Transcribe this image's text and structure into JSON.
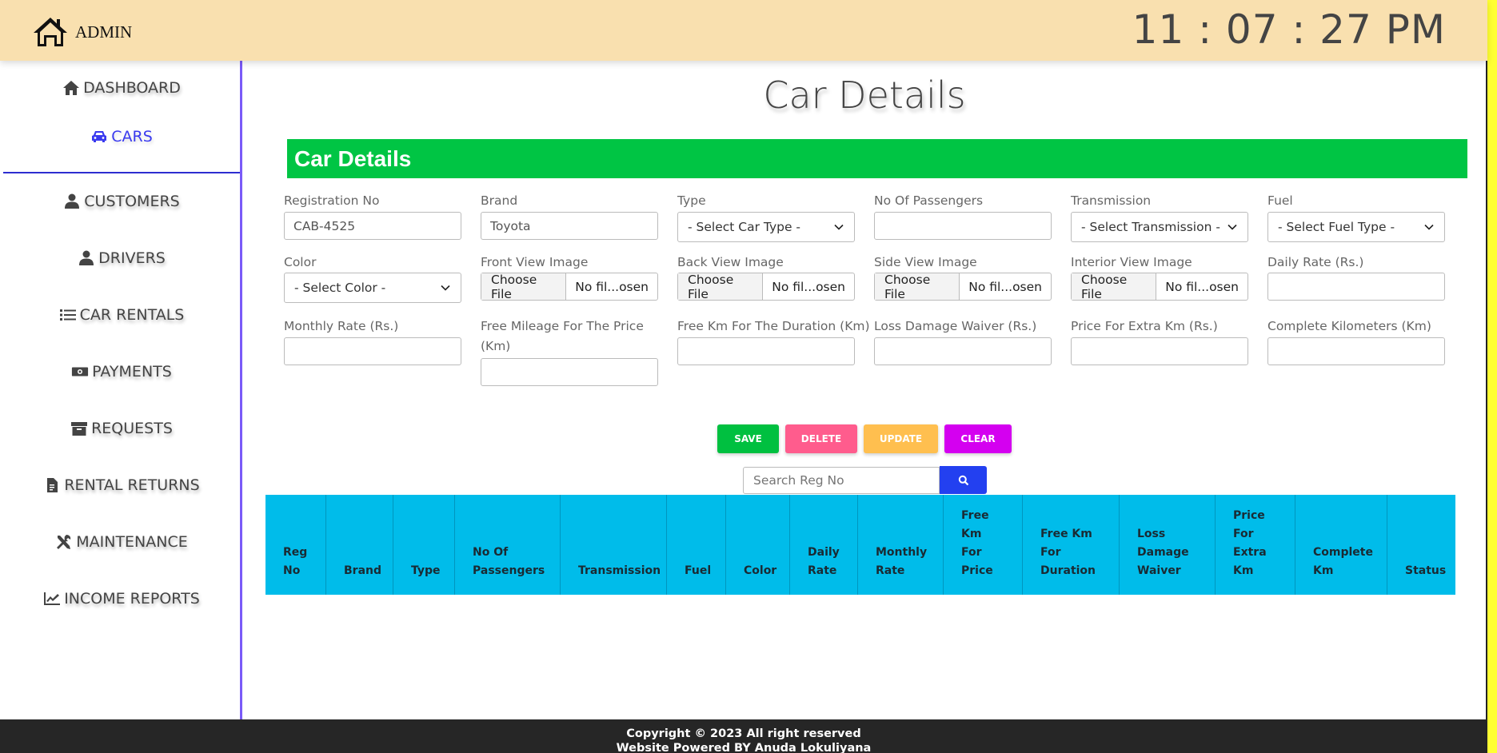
{
  "header": {
    "brand_label": "ADMIN",
    "clock": "11 : 07 : 27 PM"
  },
  "sidebar": {
    "items": [
      {
        "label": "DASHBOARD",
        "icon": "home-icon",
        "active": false
      },
      {
        "label": "CARS",
        "icon": "car-icon",
        "active": true
      },
      {
        "label": "CUSTOMERS",
        "icon": "user-icon",
        "active": false
      },
      {
        "label": "DRIVERS",
        "icon": "user-icon",
        "active": false
      },
      {
        "label": "CAR RENTALS",
        "icon": "list-icon",
        "active": false
      },
      {
        "label": "PAYMENTS",
        "icon": "money-icon",
        "active": false
      },
      {
        "label": "REQUESTS",
        "icon": "archive-icon",
        "active": false
      },
      {
        "label": "RENTAL RETURNS",
        "icon": "file-invoice-icon",
        "active": false
      },
      {
        "label": "MAINTENANCE",
        "icon": "tools-icon",
        "active": false
      },
      {
        "label": "INCOME REPORTS",
        "icon": "chart-line-icon",
        "active": false
      }
    ]
  },
  "main": {
    "page_title": "Car Details",
    "section_title": "Car Details",
    "form": {
      "registration_no": {
        "label": "Registration No",
        "value": "CAB-4525"
      },
      "brand": {
        "label": "Brand",
        "value": "Toyota"
      },
      "type": {
        "label": "Type",
        "selected": "- Select Car Type -"
      },
      "no_of_passengers": {
        "label": "No Of Passengers",
        "value": ""
      },
      "transmission": {
        "label": "Transmission",
        "selected": "- Select Transmission -"
      },
      "fuel": {
        "label": "Fuel",
        "selected": "- Select Fuel Type -"
      },
      "color": {
        "label": "Color",
        "selected": "- Select Color -"
      },
      "front_view_image": {
        "label": "Front View Image",
        "button": "Choose File",
        "file": "No fil...osen"
      },
      "back_view_image": {
        "label": "Back View Image",
        "button": "Choose File",
        "file": "No fil...osen"
      },
      "side_view_image": {
        "label": "Side View Image",
        "button": "Choose File",
        "file": "No fil...osen"
      },
      "interior_view_image": {
        "label": "Interior View Image",
        "button": "Choose File",
        "file": "No fil...osen"
      },
      "daily_rate": {
        "label": "Daily Rate (Rs.)",
        "value": ""
      },
      "monthly_rate": {
        "label": "Monthly Rate (Rs.)",
        "value": ""
      },
      "free_mileage": {
        "label": "Free Mileage For The Price (Km)",
        "value": ""
      },
      "free_km_duration": {
        "label": "Free Km For The Duration (Km)",
        "value": ""
      },
      "loss_damage_waiver": {
        "label": "Loss Damage Waiver (Rs.)",
        "value": ""
      },
      "price_extra_km": {
        "label": "Price For Extra Km (Rs.)",
        "value": ""
      },
      "complete_km": {
        "label": "Complete Kilometers (Km)",
        "value": ""
      }
    },
    "actions": {
      "save": "SAVE",
      "delete": "DELETE",
      "update": "UPDATE",
      "clear": "CLEAR"
    },
    "search": {
      "placeholder": "Search Reg No"
    },
    "table": {
      "columns": [
        "Reg No",
        "Brand",
        "Type",
        "No Of Passengers",
        "Transmission",
        "Fuel",
        "Color",
        "Daily Rate",
        "Monthly Rate",
        "Free Km For Price",
        "Free Km For Duration",
        "Loss Damage Waiver",
        "Price For Extra Km",
        "Complete Km",
        "Status"
      ],
      "rows": []
    }
  },
  "footer": {
    "line1": "Copyright © 2023 All right reserved",
    "line2": "Website Powered BY Anuda Lokuliyana"
  },
  "colors": {
    "header_bg": "#f9e0af",
    "section_bar": "#00c544",
    "active_nav": "#3a3aef",
    "sidebar_border": "#7a5af8",
    "save": "#00c040",
    "delete": "#ff5c8d",
    "update": "#ffbf4f",
    "clear": "#d400f0",
    "search_button": "#2340f0",
    "table_header": "#00bcea",
    "footer_bg": "#262626"
  }
}
